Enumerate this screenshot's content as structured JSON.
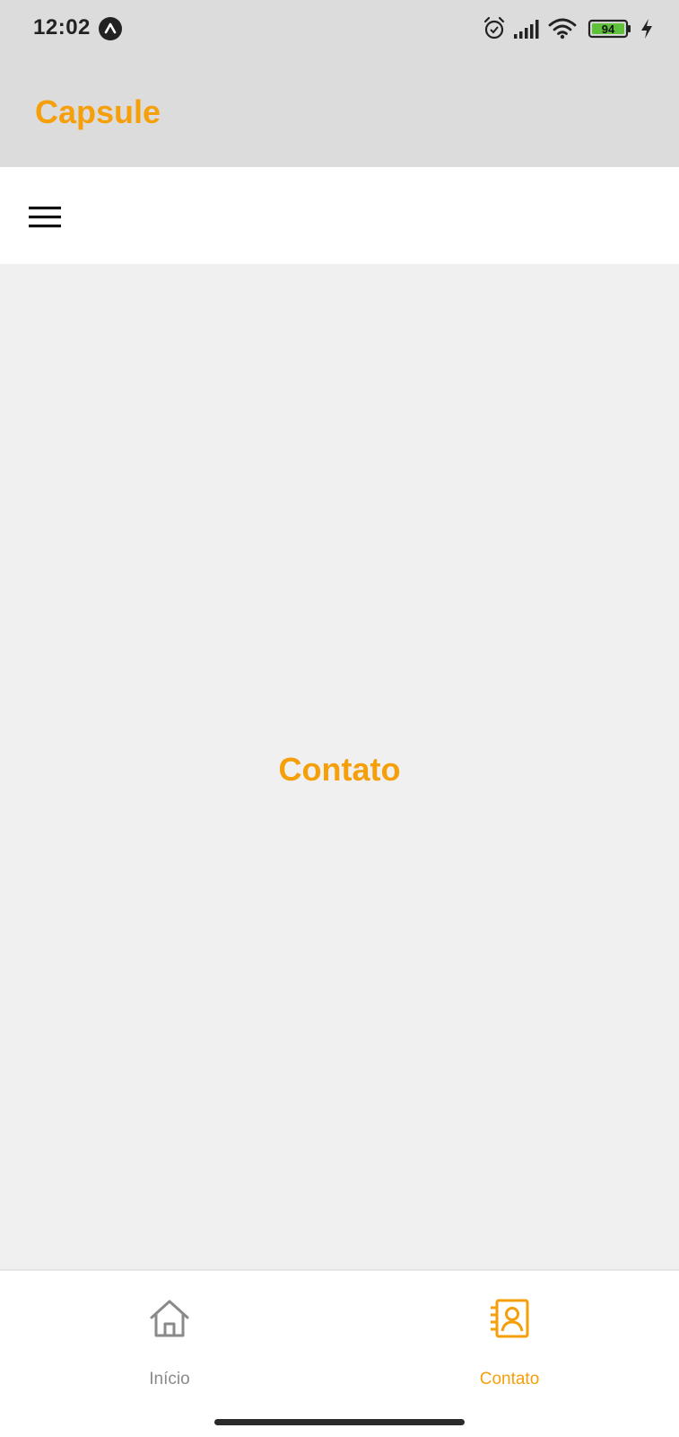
{
  "status_bar": {
    "time": "12:02",
    "battery_level": "94",
    "icons": [
      "app-notification-icon",
      "alarm-icon",
      "signal-icon",
      "wifi-icon",
      "battery-icon",
      "charging-icon"
    ]
  },
  "header": {
    "title": "Capsule"
  },
  "toolbar": {
    "menu_icon": "hamburger-menu-icon"
  },
  "content": {
    "label": "Contato"
  },
  "tabs": [
    {
      "label": "Início",
      "icon": "home-icon",
      "active": false
    },
    {
      "label": "Contato",
      "icon": "contacts-icon",
      "active": true
    }
  ],
  "colors": {
    "accent": "#f59f0a",
    "header_bg": "#dcdcdd",
    "content_bg": "#f0f0f1",
    "inactive": "#8a8a8a"
  }
}
